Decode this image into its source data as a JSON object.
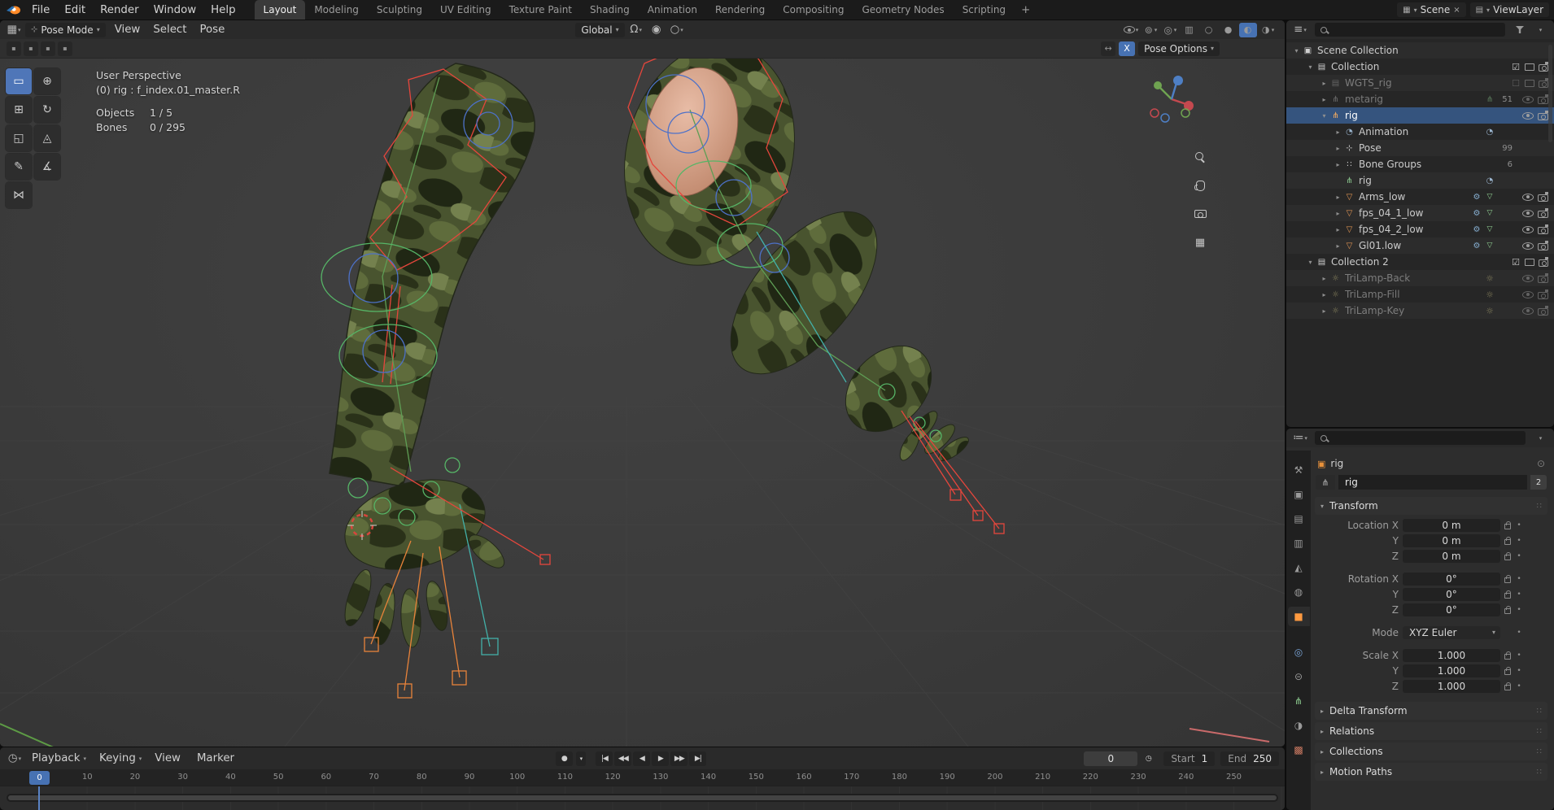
{
  "glyphs": {
    "caret": "▾",
    "caret_right": "▸",
    "dots": "∷",
    "dot": "•",
    "record": "●",
    "clock": "◷",
    "outliner_editor": "≡",
    "props_editor": "≔",
    "viewport_editor": "▦",
    "timeline_editor": "◷",
    "mirror": "↔",
    "unlink": "×"
  },
  "topbar": {
    "menus": [
      {
        "label": "File"
      },
      {
        "label": "Edit"
      },
      {
        "label": "Render"
      },
      {
        "label": "Window"
      },
      {
        "label": "Help"
      }
    ],
    "workspaces": [
      {
        "label": "Layout",
        "cls": "active"
      },
      {
        "label": "Modeling"
      },
      {
        "label": "Sculpting"
      },
      {
        "label": "UV Editing"
      },
      {
        "label": "Texture Paint"
      },
      {
        "label": "Shading"
      },
      {
        "label": "Animation"
      },
      {
        "label": "Rendering"
      },
      {
        "label": "Compositing"
      },
      {
        "label": "Geometry Nodes"
      },
      {
        "label": "Scripting"
      }
    ],
    "add_workspace": "+",
    "scene_glyph": "▦",
    "scene_label": "Scene",
    "viewlayer_glyph": "▤",
    "viewlayer_label": "ViewLayer"
  },
  "viewport": {
    "header": {
      "mode_glyph": "⊹",
      "mode_label": "Pose Mode",
      "menus": [
        {
          "label": "View"
        },
        {
          "label": "Select"
        },
        {
          "label": "Pose"
        }
      ],
      "orientation": "Global",
      "snap_glyph": "Ω",
      "proportional_glyph": "◉",
      "falloff_glyph": "○",
      "right_icons": [
        {
          "n": "visibility",
          "caret": "▾"
        },
        {
          "n": "gizmos",
          "caret": "▾"
        },
        {
          "n": "overlays",
          "caret": "▾"
        },
        {
          "n": "xray",
          "caret": ""
        },
        {
          "n": "shading-wireframe",
          "caret": ""
        },
        {
          "n": "shading-solid",
          "caret": ""
        },
        {
          "n": "shading-material",
          "caret": "",
          "cls": "on"
        },
        {
          "n": "shading-rendered",
          "caret": "▾"
        }
      ]
    },
    "tool_settings": {
      "left_icons": [
        "▪",
        "▪",
        "▪",
        "▪"
      ],
      "mirror_label": "X",
      "pose_options_label": "Pose Options"
    },
    "tools": [
      {
        "n": "select-box-tool",
        "glyph": "▭",
        "cls": "active"
      },
      {
        "n": "cursor-tool",
        "glyph": "⊕"
      },
      {
        "n": "move-tool",
        "glyph": "⊞"
      },
      {
        "n": "rotate-tool",
        "glyph": "↻"
      },
      {
        "n": "scale-tool",
        "glyph": "◱"
      },
      {
        "n": "transform-tool",
        "glyph": "◬"
      },
      {
        "n": "annotate-tool",
        "glyph": "✎"
      },
      {
        "n": "measure-tool",
        "glyph": "∡"
      },
      {
        "n": "breakdowner-tool",
        "glyph": "⋈"
      }
    ],
    "overlay": {
      "perspective": "User Perspective",
      "active_item": "(0) rig : f_index.01_master.R",
      "objects_label": "Objects",
      "objects_value": "1 / 5",
      "bones_label": "Bones",
      "bones_value": "0 / 295"
    }
  },
  "outliner": {
    "rows": [
      {
        "depth": 0,
        "exp": "▾",
        "icon": "scene-collection-icon",
        "glyph": "▣",
        "istyle": "color:#cfcfcf",
        "label": "Scene Collection",
        "badge": "",
        "mid": [],
        "right": []
      },
      {
        "depth": 1,
        "exp": "▾",
        "icon": "collection-icon",
        "glyph": "▤",
        "istyle": "color:#cfcfcf",
        "label": "Collection",
        "badge": "",
        "mid": [],
        "right": [
          "checkbox",
          "screen",
          "camera"
        ]
      },
      {
        "depth": 2,
        "exp": "▸",
        "icon": "collection-icon",
        "glyph": "▤",
        "istyle": "color:#9a9a9a",
        "label": "WGTS_rig",
        "cls": "dim",
        "badge": "",
        "mid": [],
        "right": [
          "checkbox-empty",
          "screen",
          "camera"
        ]
      },
      {
        "depth": 2,
        "exp": "▸",
        "icon": "armature-object-icon",
        "glyph": "⋔",
        "istyle": "color:#b5b5b5",
        "label": "metarig",
        "cls": "dim",
        "badge": "51",
        "mid": [
          "armaturedata"
        ],
        "right": [
          "eye",
          "camera"
        ]
      },
      {
        "depth": 2,
        "exp": "▾",
        "icon": "armature-object-icon",
        "glyph": "⋔",
        "istyle": "color:#ffb15e",
        "label": "rig",
        "cls": "sel",
        "badge": "",
        "mid": [],
        "right": [
          "eye",
          "camera"
        ]
      },
      {
        "depth": 3,
        "exp": "▸",
        "icon": "animation-data-icon",
        "glyph": "◔",
        "istyle": "color:#9ab4cd",
        "label": "Animation",
        "badge": "",
        "mid": [
          "action"
        ],
        "right": []
      },
      {
        "depth": 3,
        "exp": "▸",
        "icon": "pose-icon",
        "glyph": "⊹",
        "istyle": "color:#d0d0d0",
        "label": "Pose",
        "badge": "99",
        "mid": [],
        "right": []
      },
      {
        "depth": 3,
        "exp": "▸",
        "icon": "bone-groups-icon",
        "glyph": "∷",
        "istyle": "color:#d0d0d0",
        "label": "Bone Groups",
        "badge": "6",
        "mid": [],
        "right": []
      },
      {
        "depth": 3,
        "exp": "",
        "icon": "armature-data-icon",
        "glyph": "⋔",
        "istyle": "color:#8fce91",
        "label": "rig",
        "badge": "",
        "mid": [
          "action"
        ],
        "right": []
      },
      {
        "depth": 3,
        "exp": "▸",
        "icon": "mesh-object-icon",
        "glyph": "▽",
        "istyle": "color:#e09553",
        "label": "Arms_low",
        "badge": "",
        "mid": [
          "wrench",
          "meshdata"
        ],
        "right": [
          "eye",
          "camera"
        ]
      },
      {
        "depth": 3,
        "exp": "▸",
        "icon": "mesh-object-icon",
        "glyph": "▽",
        "istyle": "color:#e09553",
        "label": "fps_04_1_low",
        "badge": "",
        "mid": [
          "wrench",
          "meshdata"
        ],
        "right": [
          "eye",
          "camera"
        ]
      },
      {
        "depth": 3,
        "exp": "▸",
        "icon": "mesh-object-icon",
        "glyph": "▽",
        "istyle": "color:#e09553",
        "label": "fps_04_2_low",
        "badge": "",
        "mid": [
          "wrench",
          "meshdata"
        ],
        "right": [
          "eye",
          "camera"
        ]
      },
      {
        "depth": 3,
        "exp": "▸",
        "icon": "mesh-object-icon",
        "glyph": "▽",
        "istyle": "color:#e09553",
        "label": "Gl01.low",
        "badge": "",
        "mid": [
          "wrench",
          "meshdata"
        ],
        "right": [
          "eye",
          "camera"
        ]
      },
      {
        "depth": 1,
        "exp": "▾",
        "icon": "collection-icon",
        "glyph": "▤",
        "istyle": "color:#cfcfcf",
        "label": "Collection 2",
        "badge": "",
        "mid": [],
        "right": [
          "checkbox",
          "screen",
          "camera"
        ]
      },
      {
        "depth": 2,
        "exp": "▸",
        "icon": "light-object-icon",
        "glyph": "☼",
        "istyle": "color:#d8cd8a",
        "label": "TriLamp-Back",
        "cls": "dim",
        "badge": "",
        "mid": [
          "lightdata"
        ],
        "right": [
          "eye",
          "camera"
        ]
      },
      {
        "depth": 2,
        "exp": "▸",
        "icon": "light-object-icon",
        "glyph": "☼",
        "istyle": "color:#d8cd8a",
        "label": "TriLamp-Fill",
        "cls": "dim",
        "badge": "",
        "mid": [
          "lightdata"
        ],
        "right": [
          "eye",
          "camera"
        ]
      },
      {
        "depth": 2,
        "exp": "▸",
        "icon": "light-object-icon",
        "glyph": "☼",
        "istyle": "color:#d8cd8a",
        "label": "TriLamp-Key",
        "cls": "dim",
        "badge": "",
        "mid": [
          "lightdata"
        ],
        "right": [
          "eye",
          "camera"
        ]
      }
    ]
  },
  "properties": {
    "tabs": [
      {
        "icon": "tool-tab-icon",
        "glyph": "⚒"
      },
      {
        "icon": "render-tab-icon",
        "glyph": "▣"
      },
      {
        "icon": "output-tab-icon",
        "glyph": "▤"
      },
      {
        "icon": "view-layer-tab-icon",
        "glyph": "▥"
      },
      {
        "icon": "scene-tab-icon",
        "glyph": "◭"
      },
      {
        "icon": "world-tab-icon",
        "glyph": "◍"
      },
      {
        "icon": "object-tab-icon",
        "glyph": "■",
        "istyle": "color:#ff9a40",
        "cls": "active"
      },
      {
        "icon": "physics-tab-icon",
        "glyph": "◎",
        "istyle": "color:#7aa5d8",
        "cls": "gap"
      },
      {
        "icon": "constraints-tab-icon",
        "glyph": "⊝"
      },
      {
        "icon": "object-data-tab-icon",
        "glyph": "⋔",
        "istyle": "color:#8fce91"
      },
      {
        "icon": "material-tab-icon",
        "glyph": "◑"
      },
      {
        "icon": "texture-tab-icon",
        "glyph": "▩",
        "istyle": "color:#cd7a62"
      }
    ],
    "breadcrumb_glyph": "▣",
    "breadcrumb": "rig",
    "id_icon_glyph": "⋔",
    "id_name": "rig",
    "id_users": "2",
    "transform_label": "Transform",
    "transform_rows": [
      {
        "label": "Location X",
        "value": "0 m"
      },
      {
        "label": "Y",
        "value": "0 m"
      },
      {
        "label": "Z",
        "value": "0 m"
      },
      {
        "label": "Rotation X",
        "value": "0°",
        "cls": "gap"
      },
      {
        "label": "Y",
        "value": "0°"
      },
      {
        "label": "Z",
        "value": "0°"
      },
      {
        "label": "Mode",
        "value": "XYZ Euler",
        "cls": "gap drop"
      },
      {
        "label": "Scale X",
        "value": "1.000",
        "cls": "gap"
      },
      {
        "label": "Y",
        "value": "1.000"
      },
      {
        "label": "Z",
        "value": "1.000"
      }
    ],
    "sections": [
      {
        "label": "Delta Transform"
      },
      {
        "label": "Relations"
      },
      {
        "label": "Collections"
      },
      {
        "label": "Motion Paths"
      }
    ]
  },
  "timeline": {
    "menus": [
      {
        "label": "Playback",
        "caret": "▾"
      },
      {
        "label": "Keying",
        "caret": "▾"
      },
      {
        "label": "View",
        "caret": ""
      },
      {
        "label": "Marker",
        "caret": ""
      }
    ],
    "transport": [
      {
        "n": "jump-to-start-button",
        "glyph": "|◀"
      },
      {
        "n": "prev-keyframe-button",
        "glyph": "◀◀"
      },
      {
        "n": "play-reverse-button",
        "glyph": "◀"
      },
      {
        "n": "play-button",
        "glyph": "▶"
      },
      {
        "n": "next-keyframe-button",
        "glyph": "▶▶"
      },
      {
        "n": "jump-to-end-button",
        "glyph": "▶|"
      }
    ],
    "current_frame": "0",
    "start_label": "Start",
    "start_value": "1",
    "end_label": "End",
    "end_value": "250",
    "ruler": [
      "0",
      "10",
      "20",
      "30",
      "40",
      "50",
      "60",
      "70",
      "80",
      "90",
      "100",
      "110",
      "120",
      "130",
      "140",
      "150",
      "160",
      "170",
      "180",
      "190",
      "200",
      "210",
      "220",
      "230",
      "240",
      "250"
    ]
  }
}
